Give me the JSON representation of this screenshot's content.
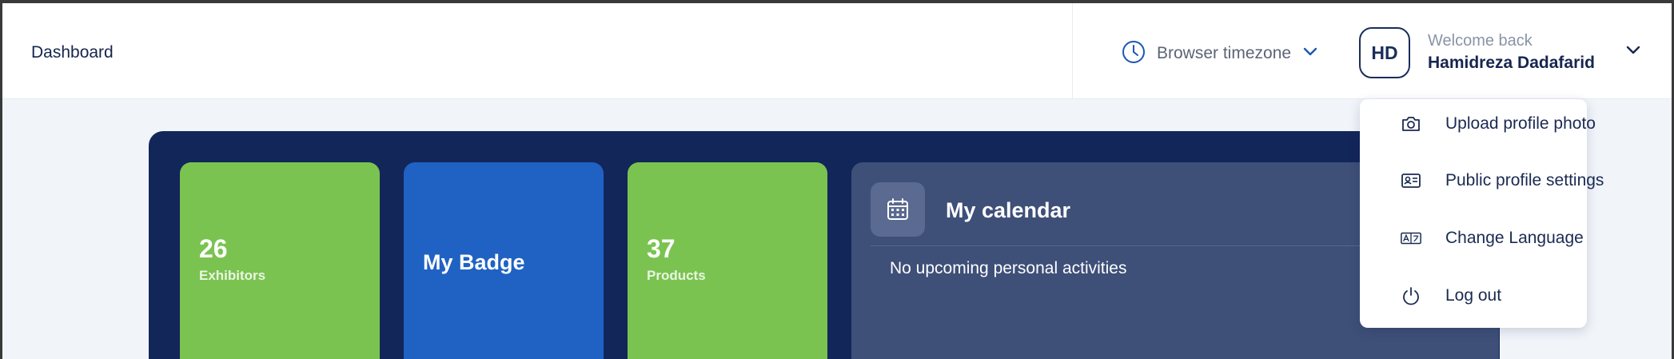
{
  "header": {
    "page_title": "Dashboard",
    "timezone_label": "Browser timezone",
    "user": {
      "initials": "HD",
      "welcome": "Welcome back",
      "name": "Hamidreza Dadafarid"
    }
  },
  "user_menu": {
    "items": [
      {
        "label": "Upload profile photo",
        "icon": "camera-icon"
      },
      {
        "label": "Public profile settings",
        "icon": "id-card-icon"
      },
      {
        "label": "Change Language",
        "icon": "translate-icon"
      },
      {
        "label": "Log out",
        "icon": "power-icon"
      }
    ]
  },
  "dashboard": {
    "tiles": [
      {
        "value": "26",
        "label": "Exhibitors",
        "color": "#7ac350"
      },
      {
        "title": "My Badge",
        "color": "#1f62c3"
      },
      {
        "value": "37",
        "label": "Products",
        "color": "#7ac350"
      }
    ],
    "calendar": {
      "title": "My calendar",
      "empty_text": "No upcoming personal activities"
    }
  },
  "colors": {
    "panel_bg": "#13265a",
    "accent_blue": "#1f62c3",
    "accent_green": "#7ac350",
    "text_dark": "#1b2a52"
  }
}
